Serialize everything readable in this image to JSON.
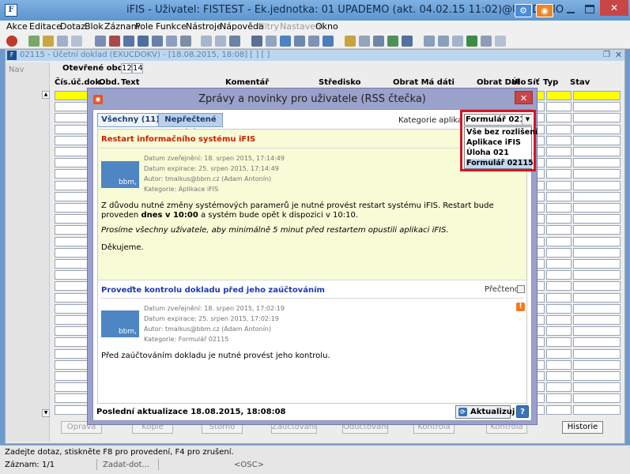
{
  "window": {
    "title": "iFIS - Uživatel: FISTEST - Ek.jednotka: 01 UPADEMO (akt. 04.02.15 11:02)@UPADEMO",
    "app_icon": "F"
  },
  "menu": [
    "Akce",
    "Editace",
    "Dotaz",
    "Blok",
    "Záznam",
    "Pole",
    "Funkce",
    "Nástroje",
    "Nápověda",
    "Filtry",
    "Nastavení",
    "Okno"
  ],
  "menu_disabled": [
    "Filtry",
    "Nastavení"
  ],
  "form": {
    "title": "02115 - Účetní doklad (EXUCDOKV) - [18.08.2015, 18:08]  [ ]  [ ]",
    "nav_label": "Nav",
    "period_label": "Otevřené období",
    "period_values": [
      "12",
      "14"
    ],
    "columns": [
      "Čís.úč.dok.",
      "Obd.",
      "Text",
      "Komentář",
      "Středisko",
      "Obrat Má dáti",
      "Obrat Dal",
      "Úlo",
      "Síť",
      "Typ",
      "Stav"
    ],
    "buttons": [
      "Oprava",
      "Kopie",
      "Storno",
      "Zaúčtování",
      "Odúčtování",
      "Kontrola",
      "Kontrola",
      "Historie"
    ]
  },
  "status": {
    "message": "Zadejte dotaz, stiskněte F8 pro provedení, F4 pro zrušení.",
    "record": "Záznam: 1/1",
    "command": "Zadat-dot...",
    "osc": "<OSC>"
  },
  "dialog": {
    "title": "Zprávy a novinky pro uživatele (RSS čtečka)",
    "tabs": {
      "all": "Všechny (11)",
      "unread": "Nepřečtené (8)"
    },
    "filter_label": "Kategorie aplikace",
    "category": {
      "selected": "Formulář 02115",
      "options": [
        "Vše bez rozlišení",
        "Aplikace iFIS",
        "Úloha 021",
        "Formulář 02115"
      ]
    },
    "news": [
      {
        "title": "Restart informačního systému iFIS",
        "thumb": "bbm,",
        "published": "Datum zveřejnění: 18. srpen 2015, 17:14:49",
        "expires": "Datum expirace: 25. srpen 2015, 17:14:49",
        "author": "Autor: tmalkus@bbm.cz (Adam Antonín)",
        "category": "Kategorie: Aplikace iFIS",
        "body1": "Z důvodu nutné změny systémových paramerů je nutné provést restart systému iFIS. Restart bude proveden",
        "body1_bold": "dnes v 10:00",
        "body1_rest": "a systém bude opět k dispozici v 10:10.",
        "body2": "Prosíme všechny uživatele, aby minimálně 5 minut před restartem opustili aplikaci iFIS.",
        "body3": "Děkujeme."
      },
      {
        "title": "Proveďte kontrolu dokladu před jeho zaúčtováním",
        "read_label": "Přečteno",
        "thumb": "bbm,",
        "published": "Datum zveřejnění: 18. srpen 2015, 17:02:19",
        "expires": "Datum expirace: 25. srpen 2015, 17:02:19",
        "author": "Autor: tmalkus@bbm.cz (Adam Antonín)",
        "category": "Kategorie: Formulář 02115",
        "body1": "Před zaúčtováním dokladu je nutné provést jeho kontrolu."
      }
    ],
    "last_update": "Poslední aktualizace 18.08.2015, 18:08:08",
    "refresh": "Aktualizuj",
    "help": "?"
  }
}
